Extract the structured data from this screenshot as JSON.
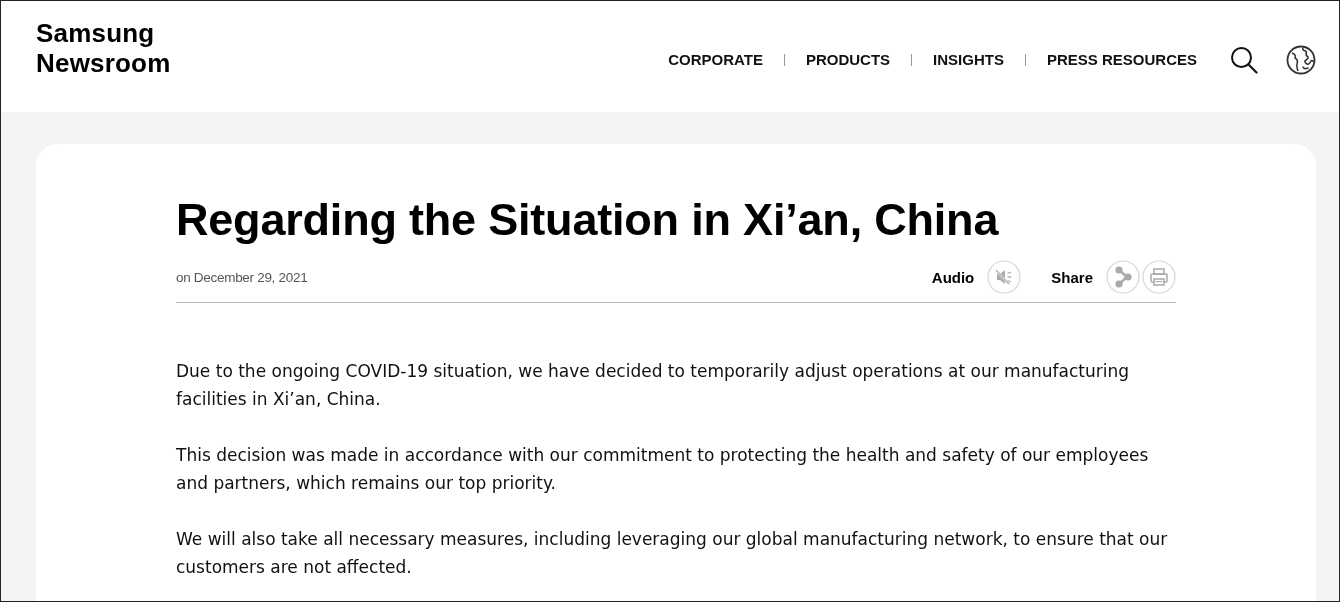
{
  "header": {
    "logo": [
      "Samsung",
      "Newsroom"
    ],
    "nav": [
      {
        "label": "CORPORATE"
      },
      {
        "label": "PRODUCTS"
      },
      {
        "label": "INSIGHTS"
      },
      {
        "label": "PRESS RESOURCES"
      }
    ]
  },
  "article": {
    "title": "Regarding the Situation in Xi’an, China",
    "date": "on December 29, 2021",
    "audio_label": "Audio",
    "share_label": "Share",
    "paragraphs": [
      "Due to the ongoing COVID-19 situation, we have decided to temporarily adjust operations at our manufacturing facilities in Xi’an, China.",
      "This decision was made in accordance with our commitment to protecting the health and safety of our employees and partners, which remains our top priority.",
      "We will also take all necessary measures, including leveraging our global manufacturing network, to ensure that our customers are not affected."
    ]
  }
}
